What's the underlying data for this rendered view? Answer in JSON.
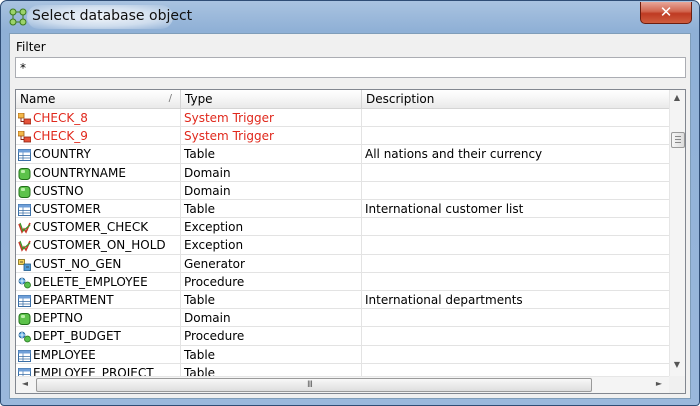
{
  "window": {
    "title": "Select database object",
    "close_glyph": "✕",
    "icon": "database-objects-icon"
  },
  "filter": {
    "label": "Filter",
    "value": "*"
  },
  "grid": {
    "columns": [
      "Name",
      "Type",
      "Description"
    ],
    "sort_indicator": "/",
    "rows": [
      {
        "name": "CHECK_8",
        "type": "System Trigger",
        "description": "",
        "icon": "trigger-icon",
        "highlight": true
      },
      {
        "name": "CHECK_9",
        "type": "System Trigger",
        "description": "",
        "icon": "trigger-icon",
        "highlight": true
      },
      {
        "name": "COUNTRY",
        "type": "Table",
        "description": "All nations and their currency",
        "icon": "table-icon"
      },
      {
        "name": "COUNTRYNAME",
        "type": "Domain",
        "description": "",
        "icon": "domain-icon"
      },
      {
        "name": "CUSTNO",
        "type": "Domain",
        "description": "",
        "icon": "domain-icon"
      },
      {
        "name": "CUSTOMER",
        "type": "Table",
        "description": "International customer list",
        "icon": "table-icon"
      },
      {
        "name": "CUSTOMER_CHECK",
        "type": "Exception",
        "description": "",
        "icon": "exception-icon"
      },
      {
        "name": "CUSTOMER_ON_HOLD",
        "type": "Exception",
        "description": "",
        "icon": "exception-icon"
      },
      {
        "name": "CUST_NO_GEN",
        "type": "Generator",
        "description": "",
        "icon": "generator-icon"
      },
      {
        "name": "DELETE_EMPLOYEE",
        "type": "Procedure",
        "description": "",
        "icon": "procedure-icon"
      },
      {
        "name": "DEPARTMENT",
        "type": "Table",
        "description": "International departments",
        "icon": "table-icon"
      },
      {
        "name": "DEPTNO",
        "type": "Domain",
        "description": "",
        "icon": "domain-icon"
      },
      {
        "name": "DEPT_BUDGET",
        "type": "Procedure",
        "description": "",
        "icon": "procedure-icon"
      },
      {
        "name": "EMPLOYEE",
        "type": "Table",
        "description": "",
        "icon": "table-icon"
      },
      {
        "name": "EMPLOYEE_PROJECT",
        "type": "Table",
        "description": "",
        "icon": "table-icon"
      }
    ]
  },
  "scrollbars": {
    "up": "▲",
    "down": "▼",
    "left": "◄",
    "right": "►",
    "grip": "III"
  },
  "colors": {
    "highlight_text": "#e0281c",
    "titlebar": "#8fb0d6",
    "close_button": "#c9452b"
  }
}
